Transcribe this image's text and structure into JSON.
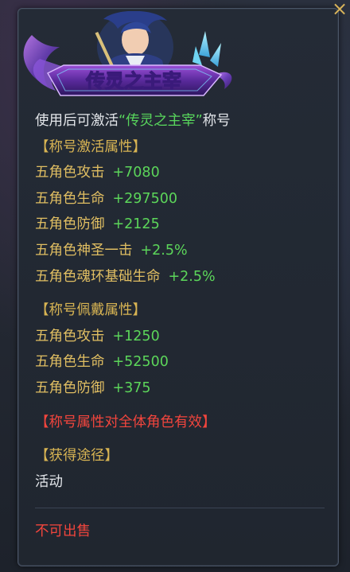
{
  "title_banner": {
    "text": "传灵之主宰",
    "icon": "character-portrait-icon"
  },
  "close_icon": "×",
  "description": {
    "prefix": "使用后可激活",
    "title_quoted": "“传灵之主宰”",
    "suffix": "称号"
  },
  "activation_section": {
    "header": "【称号激活属性】",
    "stats": [
      {
        "name": "五角色攻击",
        "value": "+7080"
      },
      {
        "name": "五角色生命",
        "value": "+297500"
      },
      {
        "name": "五角色防御",
        "value": "+2125"
      },
      {
        "name": "五角色神圣一击",
        "value": "+2.5%"
      },
      {
        "name": "五角色魂环基础生命",
        "value": "+2.5%"
      }
    ]
  },
  "wear_section": {
    "header": "【称号佩戴属性】",
    "stats": [
      {
        "name": "五角色攻击",
        "value": "+1250"
      },
      {
        "name": "五角色生命",
        "value": "+52500"
      },
      {
        "name": "五角色防御",
        "value": "+375"
      }
    ]
  },
  "notice": "【称号属性对全体角色有效】",
  "source_section": {
    "header": "【获得途径】",
    "value": "活动"
  },
  "footer": {
    "not_for_sale": "不可出售"
  },
  "colors": {
    "gold": "#d8b453",
    "green": "#58d65c",
    "red": "#f2453d",
    "white": "#e3e6ea"
  }
}
